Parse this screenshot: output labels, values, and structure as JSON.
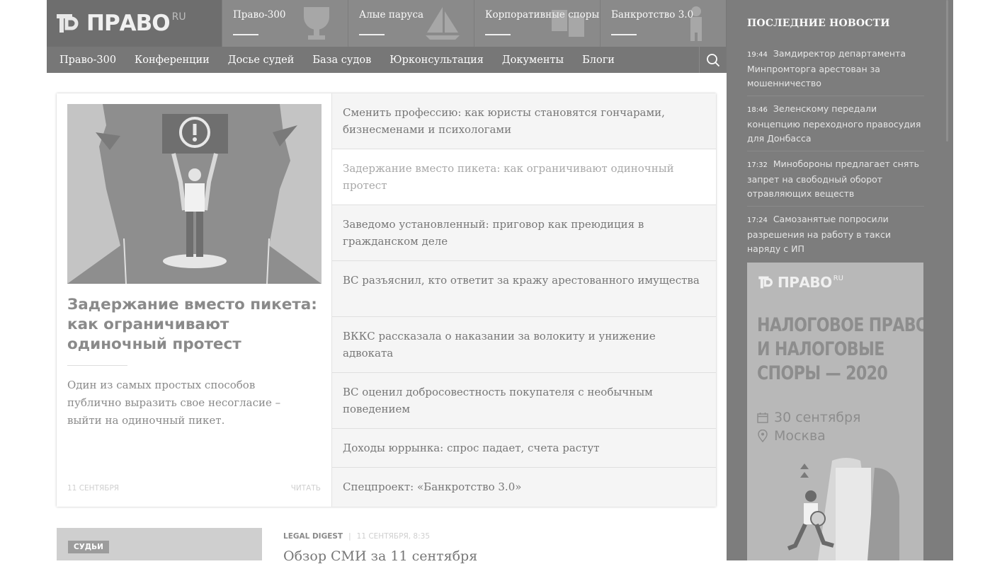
{
  "header": {
    "logo_text": "ПРАВО",
    "logo_suffix": "RU",
    "promos": [
      {
        "label": "Право-300"
      },
      {
        "label": "Алые паруса"
      },
      {
        "label": "Корпоративные споры"
      },
      {
        "label": "Банкротство 3.0"
      }
    ],
    "nav": [
      {
        "label": "Право-300"
      },
      {
        "label": "Конференции"
      },
      {
        "label": "Досье судей"
      },
      {
        "label": "База судов"
      },
      {
        "label": "Юрконсультация"
      },
      {
        "label": "Документы"
      },
      {
        "label": "Блоги"
      }
    ]
  },
  "feature": {
    "title": "Задержание вместо пикета: как ограничивают одиночный протест",
    "lead": "Один из самых простых способов публично выразить свое несогласие – выйти на одиночный пикет.",
    "date": "11 СЕНТЯБРЯ",
    "read_label": "ЧИТАТЬ"
  },
  "articles": [
    {
      "title": "Сменить профессию: как юристы становятся гончарами, бизнесменами и психологами"
    },
    {
      "title": "Задержание вместо пикета: как ограничивают одиночный протест"
    },
    {
      "title": "Заведомо установленный: приговор как преюдиция в гражданском деле"
    },
    {
      "title": "ВС разъяснил, кто ответит за кражу арестованного имущества"
    },
    {
      "title": "ВККС рассказала о наказании за волокиту и унижение адвоката"
    },
    {
      "title": "ВС оценил добросовестность покупателя с необычным поведением"
    },
    {
      "title": "Доходы юррынка: спрос падает, счета растут"
    },
    {
      "title": "Спецпроект: «Банкротство 3.0»"
    }
  ],
  "second": {
    "tag": "СУДЬИ",
    "category": "LEGAL DIGEST",
    "separator": "|",
    "date": "11 СЕНТЯБРЯ, 8:35",
    "title": "Обзор СМИ за 11 сентября"
  },
  "sidebar": {
    "title": "ПОСЛЕДНИЕ НОВОСТИ",
    "news": [
      {
        "time": "19:44",
        "text": "Замдиректор департамента Минпромторга арестован за мошенничество"
      },
      {
        "time": "18:46",
        "text": "Зеленскому передали концепцию переходного правосудия для Донбасса"
      },
      {
        "time": "17:32",
        "text": "Минобороны предлагает снять запрет на свободный оборот отравляющих веществ"
      },
      {
        "time": "17:24",
        "text": "Самозанятые попросили разрешения на работу в такси наряду с ИП"
      }
    ],
    "banner": {
      "logo_text": "ПРАВО",
      "logo_suffix": "RU",
      "heading_lines": [
        "НАЛОГОВОЕ ПРАВО",
        "И НАЛОГОВЫЕ",
        "СПОРЫ — 2020"
      ],
      "date": "30 сентября",
      "city": "Москва",
      "icons": {
        "date": "calendar-icon",
        "city": "location-pin-icon"
      }
    }
  }
}
